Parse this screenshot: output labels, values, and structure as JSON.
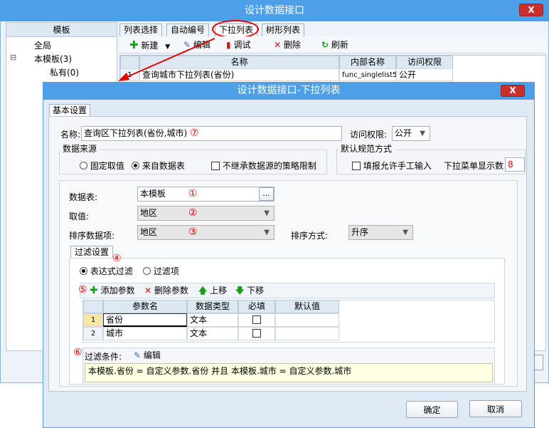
{
  "outer": {
    "title": "设计数据接口",
    "close": "X",
    "sidebar_header": "模板",
    "tree": [
      "全局",
      "本模板(3)",
      "私有(0)"
    ],
    "tree_toggle": "⊟",
    "tabs": [
      "列表选择",
      "自动编号",
      "下拉列表",
      "树形列表"
    ],
    "toolbar": {
      "new": "新建",
      "edit": "编辑",
      "debug": "调试",
      "delete": "删除",
      "refresh": "刷新"
    },
    "grid_headers": [
      "名称",
      "内部名称",
      "访问权限"
    ],
    "grid_row": {
      "num": "1",
      "name": "查询城市下拉列表(省份)",
      "internal": "func_singlelist5",
      "access": "公开"
    }
  },
  "dialog": {
    "title": "设计数据接口-下拉列表",
    "close": "X",
    "tab": "基本设置",
    "name_label": "名称:",
    "name_value": "查询区下拉列表(省份,城市)",
    "access_label": "访问权限:",
    "access_value": "公开",
    "source_legend": "数据来源",
    "source_fixed": "固定取值",
    "source_dataset": "来自数据表",
    "source_no_inherit": "不继承数据源的策略限制",
    "default_legend": "默认规范方式",
    "allow_manual": "填报允许手工输入",
    "dropdown_count_label": "下拉菜单显示数",
    "dropdown_count_value": "8",
    "table_label": "数据表:",
    "table_value": "本模板",
    "table_browse": "...",
    "value_label": "取值:",
    "value_value": "地区",
    "sort_item_label": "排序数据项:",
    "sort_item_value": "地区",
    "sort_mode_label": "排序方式:",
    "sort_mode_value": "升序",
    "filter_tab": "过滤设置",
    "filter_expr": "表达式过滤",
    "filter_items": "过滤项",
    "add_param": "添加参数",
    "del_param": "删除参数",
    "move_up": "上移",
    "move_down": "下移",
    "param_headers": [
      "参数名",
      "数据类型",
      "必填",
      "默认值"
    ],
    "params": [
      {
        "num": "1",
        "name": "省份",
        "type": "文本"
      },
      {
        "num": "2",
        "name": "城市",
        "type": "文本"
      }
    ],
    "condition_label": "过滤条件:",
    "condition_edit": "编辑",
    "condition_text": "本模板.省份 = 自定义参数.省份 并且 本模板.城市 = 自定义参数.城市",
    "ok": "确定",
    "cancel": "取消"
  },
  "markers": {
    "m1": "①",
    "m2": "②",
    "m3": "③",
    "m4": "④",
    "m5": "⑤",
    "m6": "⑥",
    "m7": "⑦"
  },
  "colors": {
    "title_bar": "#4d9fe7",
    "close": "#c9302c",
    "accent_red": "#e00000",
    "condition_bg": "#ffffe1"
  }
}
